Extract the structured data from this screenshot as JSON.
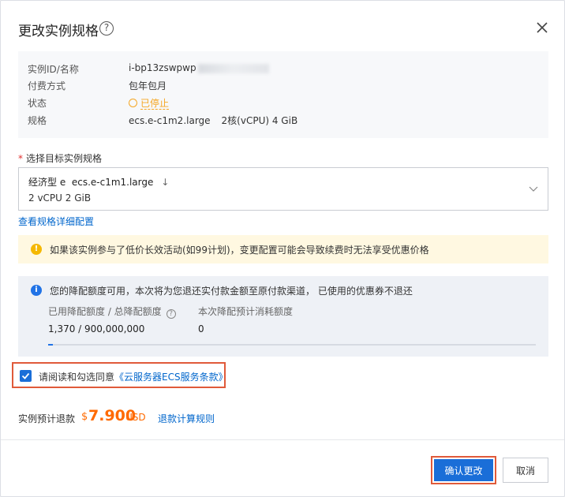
{
  "dialog": {
    "title": "更改实例规格",
    "help_icon": "?",
    "close_icon": "close-icon"
  },
  "instance_info": {
    "id_label": "实例ID/名称",
    "id_value": "i-bp13zswpwp",
    "billing_label": "付费方式",
    "billing_value": "包年包月",
    "status_label": "状态",
    "status_value": "已停止",
    "spec_label": "规格",
    "spec_value": "ecs.e-c1m2.large",
    "spec_detail": "2核(vCPU)  4 GiB"
  },
  "target_spec": {
    "label": "选择目标实例规格",
    "family": "经济型 e",
    "type": "ecs.e-c1m1.large",
    "arrow": "↓",
    "detail": "2 vCPU  2 GiB"
  },
  "links": {
    "view_spec_detail": "查看规格详细配置",
    "refund_rules": "退款计算规则"
  },
  "warning": {
    "icon": "!",
    "text": "如果该实例参与了低价长效活动(如99计划)，变更配置可能会导致续费时无法享受优惠价格"
  },
  "quota": {
    "icon": "i",
    "message": "您的降配额度可用，本次将为您退还实付款金额至原付款渠道， 已使用的优惠券不退还",
    "used_total_label": "已用降配额度 / 总降配额度",
    "help_icon": "?",
    "consume_label": "本次降配预计消耗额度",
    "used_total_value": "1,370 / 900,000,000",
    "consume_value": "0",
    "progress": 0.01
  },
  "agreement": {
    "text": "请阅读和勾选同意",
    "link": "《云服务器ECS服务条款》",
    "checked": true
  },
  "refund": {
    "label": "实例预计退款",
    "symbol": "$",
    "amount": "7.900",
    "currency": "USD"
  },
  "buttons": {
    "confirm": "确认更改",
    "cancel": "取消"
  },
  "colors": {
    "accent": "#1a6ed8",
    "link": "#0066cc",
    "warning": "#f5a623",
    "price": "#ff6a00",
    "highlight": "#e05a3a"
  }
}
